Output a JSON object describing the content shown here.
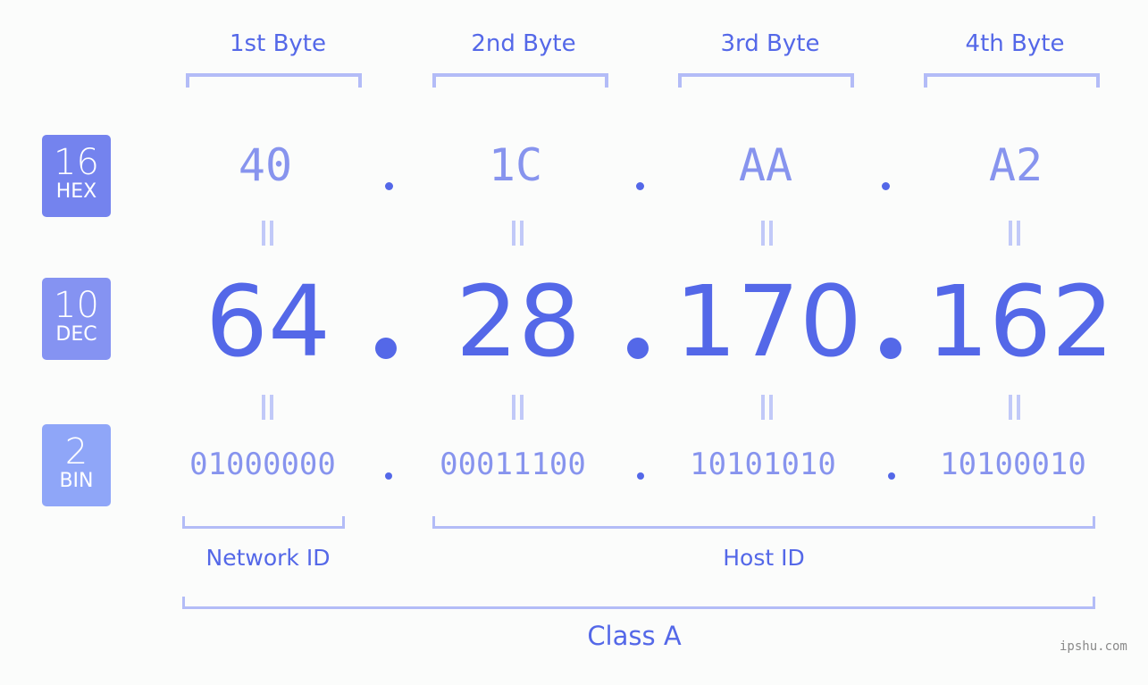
{
  "ip_address": "64.28.170.162",
  "colors": {
    "hex_badge": "#7483ee",
    "dec_badge": "#8593f2",
    "bin_badge": "#8fa6f8",
    "primary_text": "#5468e8",
    "secondary_text": "#8794ee",
    "bracket": "#b3bcf7"
  },
  "bytes": [
    {
      "header": "1st Byte",
      "hex": "40",
      "dec": "64",
      "bin": "01000000"
    },
    {
      "header": "2nd Byte",
      "hex": "1C",
      "dec": "28",
      "bin": "00011100"
    },
    {
      "header": "3rd Byte",
      "hex": "AA",
      "dec": "170",
      "bin": "10101010"
    },
    {
      "header": "4th Byte",
      "hex": "A2",
      "dec": "162",
      "bin": "10100010"
    }
  ],
  "badges": {
    "hex": {
      "base": "16",
      "label": "HEX"
    },
    "dec": {
      "base": "10",
      "label": "DEC"
    },
    "bin": {
      "base": "2",
      "label": "BIN"
    }
  },
  "separator": ".",
  "equals_icon": "equals-icon",
  "labels": {
    "network_id": "Network ID",
    "host_id": "Host ID",
    "ip_class": "Class A"
  },
  "watermark": "ipshu.com"
}
